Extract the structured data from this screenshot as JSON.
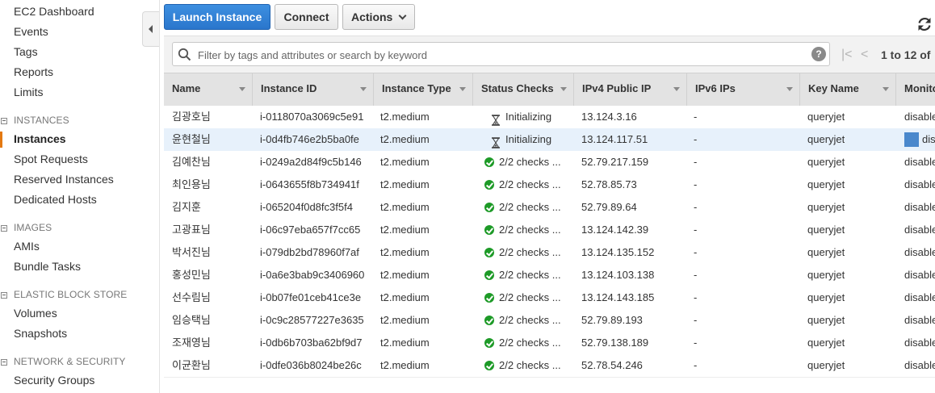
{
  "sidebar": {
    "top_items": [
      "EC2 Dashboard",
      "Events",
      "Tags",
      "Reports",
      "Limits"
    ],
    "sections": [
      {
        "header": "INSTANCES",
        "items": [
          "Instances",
          "Spot Requests",
          "Reserved Instances",
          "Dedicated Hosts"
        ],
        "active_index": 0
      },
      {
        "header": "IMAGES",
        "items": [
          "AMIs",
          "Bundle Tasks"
        ]
      },
      {
        "header": "ELASTIC BLOCK STORE",
        "items": [
          "Volumes",
          "Snapshots"
        ]
      },
      {
        "header": "NETWORK & SECURITY",
        "items": [
          "Security Groups"
        ]
      }
    ]
  },
  "toolbar": {
    "launch_label": "Launch Instance",
    "connect_label": "Connect",
    "actions_label": "Actions"
  },
  "search": {
    "placeholder": "Filter by tags and attributes or search by keyword",
    "help": "?"
  },
  "pagination": {
    "text": "1 to 12 of"
  },
  "table": {
    "columns": [
      "Name",
      "Instance ID",
      "Instance Type",
      "Status Checks",
      "IPv4 Public IP",
      "IPv6 IPs",
      "Key Name",
      "Monito"
    ],
    "rows": [
      {
        "name": "김광호님",
        "id": "i-0118070a3069c5e91",
        "type": "t2.medium",
        "status": "Initializing",
        "status_kind": "hourglass",
        "ip": "13.124.3.16",
        "ipv6": "-",
        "key": "queryjet",
        "monitoring": "disable",
        "selected": false
      },
      {
        "name": "윤현철님",
        "id": "i-0d4fb746e2b5ba0fe",
        "type": "t2.medium",
        "status": "Initializing",
        "status_kind": "hourglass",
        "ip": "13.124.117.51",
        "ipv6": "-",
        "key": "queryjet",
        "monitoring": "dis",
        "selected": true
      },
      {
        "name": "김예찬님",
        "id": "i-0249a2d84f9c5b146",
        "type": "t2.medium",
        "status": "2/2 checks ...",
        "status_kind": "ok",
        "ip": "52.79.217.159",
        "ipv6": "-",
        "key": "queryjet",
        "monitoring": "disable",
        "selected": false
      },
      {
        "name": "최인용님",
        "id": "i-0643655f8b734941f",
        "type": "t2.medium",
        "status": "2/2 checks ...",
        "status_kind": "ok",
        "ip": "52.78.85.73",
        "ipv6": "-",
        "key": "queryjet",
        "monitoring": "disable",
        "selected": false
      },
      {
        "name": "김지훈",
        "id": "i-065204f0d8fc3f5f4",
        "type": "t2.medium",
        "status": "2/2 checks ...",
        "status_kind": "ok",
        "ip": "52.79.89.64",
        "ipv6": "-",
        "key": "queryjet",
        "monitoring": "disable",
        "selected": false
      },
      {
        "name": "고광표님",
        "id": "i-06c97eba657f7cc65",
        "type": "t2.medium",
        "status": "2/2 checks ...",
        "status_kind": "ok",
        "ip": "13.124.142.39",
        "ipv6": "-",
        "key": "queryjet",
        "monitoring": "disable",
        "selected": false
      },
      {
        "name": "박서진님",
        "id": "i-079db2bd78960f7af",
        "type": "t2.medium",
        "status": "2/2 checks ...",
        "status_kind": "ok",
        "ip": "13.124.135.152",
        "ipv6": "-",
        "key": "queryjet",
        "monitoring": "disable",
        "selected": false
      },
      {
        "name": "홍성민님",
        "id": "i-0a6e3bab9c3406960",
        "type": "t2.medium",
        "status": "2/2 checks ...",
        "status_kind": "ok",
        "ip": "13.124.103.138",
        "ipv6": "-",
        "key": "queryjet",
        "monitoring": "disable",
        "selected": false
      },
      {
        "name": "선수림님",
        "id": "i-0b07fe01ceb41ce3e",
        "type": "t2.medium",
        "status": "2/2 checks ...",
        "status_kind": "ok",
        "ip": "13.124.143.185",
        "ipv6": "-",
        "key": "queryjet",
        "monitoring": "disable",
        "selected": false
      },
      {
        "name": "임승택님",
        "id": "i-0c9c28577227e3635",
        "type": "t2.medium",
        "status": "2/2 checks ...",
        "status_kind": "ok",
        "ip": "52.79.89.193",
        "ipv6": "-",
        "key": "queryjet",
        "monitoring": "disable",
        "selected": false
      },
      {
        "name": "조재영님",
        "id": "i-0db6b703ba62bf9d7",
        "type": "t2.medium",
        "status": "2/2 checks ...",
        "status_kind": "ok",
        "ip": "52.79.138.189",
        "ipv6": "-",
        "key": "queryjet",
        "monitoring": "disable",
        "selected": false
      },
      {
        "name": "이균환님",
        "id": "i-0dfe036b8024be26c",
        "type": "t2.medium",
        "status": "2/2 checks ...",
        "status_kind": "ok",
        "ip": "52.78.54.246",
        "ipv6": "-",
        "key": "queryjet",
        "monitoring": "disable",
        "selected": false
      }
    ]
  },
  "colors": {
    "primary": "#2a76cc",
    "active_marker": "#e47911",
    "ok": "#1d9a27",
    "selected_row": "#e7f1fb"
  },
  "icons": {
    "search": "search-icon",
    "help": "help-icon",
    "refresh": "refresh-icon",
    "hourglass": "hourglass-icon",
    "ok": "check-circle-icon",
    "collapse": "collapse-sidebar-icon"
  }
}
